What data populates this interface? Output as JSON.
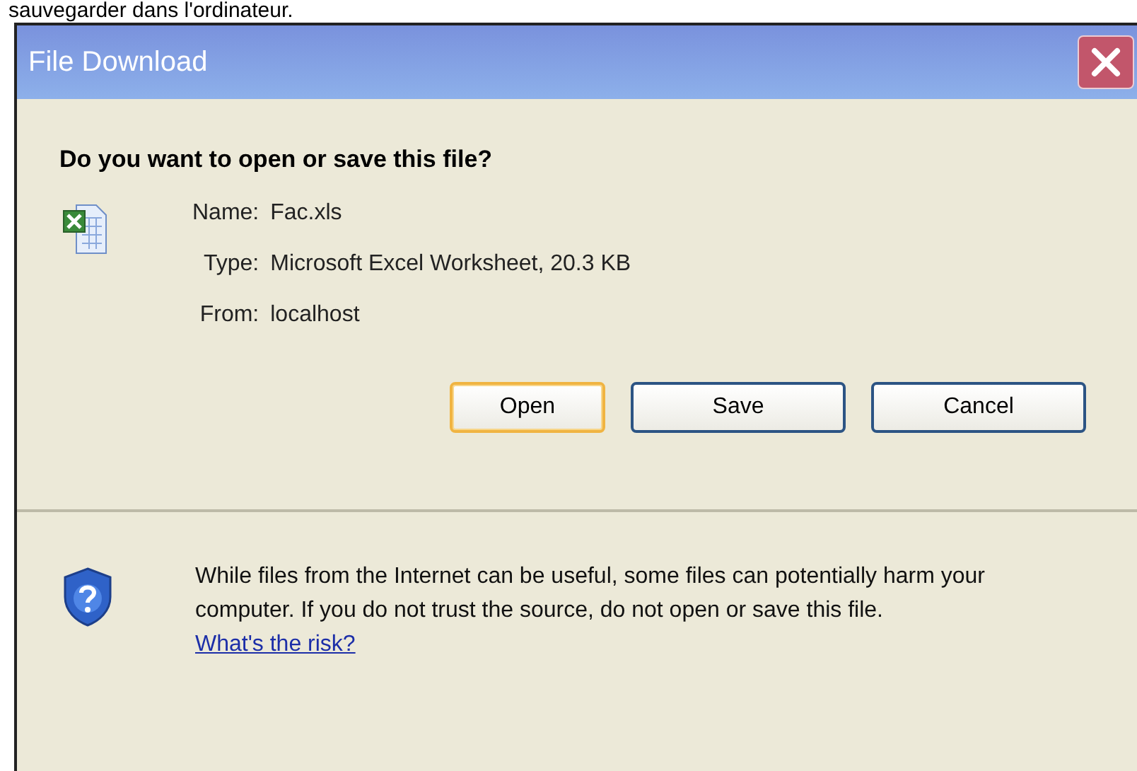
{
  "page_text": "sauvegarder dans l'ordinateur.",
  "window": {
    "title": "File Download"
  },
  "question": "Do you want to open or save this file?",
  "file_info": [
    {
      "label": "Name:",
      "value": "Fac.xls"
    },
    {
      "label": "Type:",
      "value": "Microsoft Excel Worksheet, 20.3 KB"
    },
    {
      "label": "From:",
      "value": "localhost"
    }
  ],
  "buttons": [
    {
      "label": "Open",
      "selected": true
    },
    {
      "label": "Save",
      "selected": false
    },
    {
      "label": "Cancel",
      "selected": false
    }
  ],
  "warning": {
    "text": "While files from the Internet can be useful, some files can potentially harm your computer. If you do not trust the source, do not open or save this file.",
    "link": "What's the risk?"
  }
}
